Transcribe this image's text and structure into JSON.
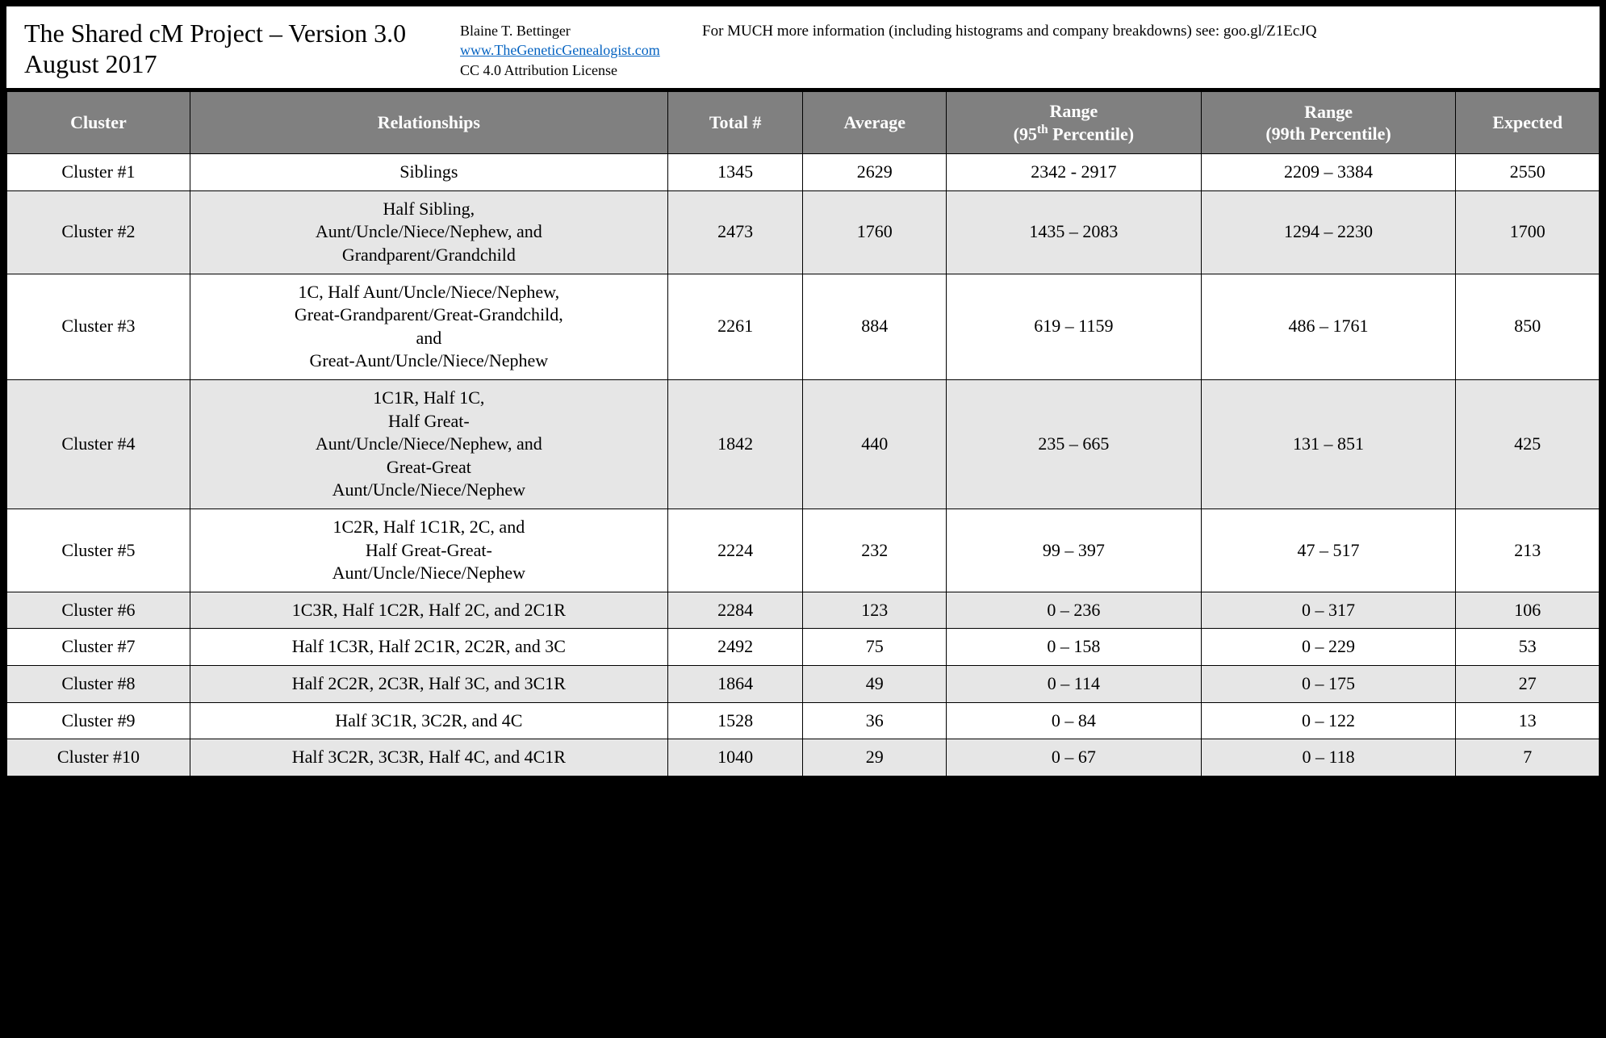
{
  "header": {
    "title_line1": "The Shared cM Project – Version 3.0",
    "title_line2": "August 2017",
    "author": "Blaine T. Bettinger",
    "url": "www.TheGeneticGenealogist.com",
    "license": "CC 4.0 Attribution License",
    "info_text": "For MUCH more information (including histograms and company breakdowns) see: goo.gl/Z1EcJQ"
  },
  "columns": {
    "cluster": "Cluster",
    "relationships": "Relationships",
    "total": "Total #",
    "average": "Average",
    "range95_line1": "Range",
    "range95_line2_pre": "(95",
    "range95_line2_sup": "th",
    "range95_line2_post": " Percentile)",
    "range99_line1": "Range",
    "range99_line2": "(99th Percentile)",
    "expected": "Expected"
  },
  "rows": [
    {
      "cluster": "Cluster #1",
      "rel": "Siblings",
      "total": "1345",
      "avg": "2629",
      "r95": "2342 - 2917",
      "r99": "2209 – 3384",
      "exp": "2550"
    },
    {
      "cluster": "Cluster #2",
      "rel": "Half Sibling,\nAunt/Uncle/Niece/Nephew, and\nGrandparent/Grandchild",
      "total": "2473",
      "avg": "1760",
      "r95": "1435 – 2083",
      "r99": "1294 – 2230",
      "exp": "1700"
    },
    {
      "cluster": "Cluster #3",
      "rel": "1C, Half Aunt/Uncle/Niece/Nephew,\nGreat-Grandparent/Great-Grandchild,\nand\nGreat-Aunt/Uncle/Niece/Nephew",
      "total": "2261",
      "avg": "884",
      "r95": "619 – 1159",
      "r99": "486 – 1761",
      "exp": "850"
    },
    {
      "cluster": "Cluster #4",
      "rel": "1C1R, Half 1C,\nHalf Great-\nAunt/Uncle/Niece/Nephew, and\nGreat-Great\nAunt/Uncle/Niece/Nephew",
      "total": "1842",
      "avg": "440",
      "r95": "235 – 665",
      "r99": "131 – 851",
      "exp": "425"
    },
    {
      "cluster": "Cluster #5",
      "rel": "1C2R, Half 1C1R, 2C, and\nHalf Great-Great-\nAunt/Uncle/Niece/Nephew",
      "total": "2224",
      "avg": "232",
      "r95": "99 – 397",
      "r99": "47 – 517",
      "exp": "213"
    },
    {
      "cluster": "Cluster #6",
      "rel": "1C3R, Half 1C2R, Half 2C, and 2C1R",
      "total": "2284",
      "avg": "123",
      "r95": "0 – 236",
      "r99": "0 – 317",
      "exp": "106"
    },
    {
      "cluster": "Cluster #7",
      "rel": "Half 1C3R, Half 2C1R, 2C2R, and 3C",
      "total": "2492",
      "avg": "75",
      "r95": "0 – 158",
      "r99": "0 – 229",
      "exp": "53"
    },
    {
      "cluster": "Cluster #8",
      "rel": "Half 2C2R, 2C3R, Half 3C, and 3C1R",
      "total": "1864",
      "avg": "49",
      "r95": "0 – 114",
      "r99": "0 – 175",
      "exp": "27"
    },
    {
      "cluster": "Cluster #9",
      "rel": "Half 3C1R, 3C2R, and 4C",
      "total": "1528",
      "avg": "36",
      "r95": "0 – 84",
      "r99": "0 – 122",
      "exp": "13"
    },
    {
      "cluster": "Cluster #10",
      "rel": "Half 3C2R, 3C3R, Half 4C, and 4C1R",
      "total": "1040",
      "avg": "29",
      "r95": "0 – 67",
      "r99": "0 – 118",
      "exp": "7"
    }
  ]
}
